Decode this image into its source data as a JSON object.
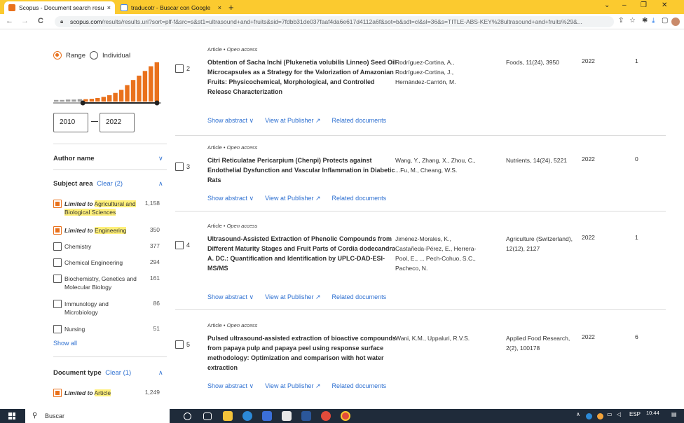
{
  "browser": {
    "tabs": [
      {
        "title": "Scopus - Document search results",
        "close": "×"
      },
      {
        "title": "traducotr - Buscar con Google",
        "close": "×"
      }
    ],
    "new_tab": "+",
    "window_controls": {
      "chevron": "⌄",
      "minimize": "–",
      "maximize": "❐",
      "close": "✕"
    },
    "nav": {
      "back": "←",
      "forward": "→",
      "reload": "C"
    },
    "url_host": "scopus.com",
    "url_path": "/results/results.uri?sort=plf-f&src=s&st1=ultrasound+and+fruits&sid=7fdbb31de037faaf4da6e617d4112a6f&sot=b&sdt=cl&sl=36&s=TITLE-ABS-KEY%28ultrasound+and+fruits%29&..."
  },
  "sidebar": {
    "range_label": "Range",
    "individual_label": "Individual",
    "histogram": {
      "values": [
        0.04,
        0.04,
        0.05,
        0.05,
        0.06,
        0.06,
        0.07,
        0.09,
        0.12,
        0.16,
        0.22,
        0.3,
        0.42,
        0.55,
        0.66,
        0.78,
        0.9,
        1.0
      ],
      "highlight_from": 5
    },
    "year_from": "2010",
    "year_to": "2022",
    "author_name": "Author name",
    "subject_area": "Subject area",
    "subject_clear": "Clear (2)",
    "subject_items": [
      {
        "prefix": "Limited to",
        "label": "Agricultural and Biological Sciences",
        "count": "1,158",
        "checked": true
      },
      {
        "prefix": "Limited to",
        "label": "Engineering",
        "count": "350",
        "checked": true
      },
      {
        "prefix": "",
        "label": "Chemistry",
        "count": "377",
        "checked": false
      },
      {
        "prefix": "",
        "label": "Chemical Engineering",
        "count": "294",
        "checked": false
      },
      {
        "prefix": "",
        "label": "Biochemistry, Genetics and Molecular Biology",
        "count": "161",
        "checked": false
      },
      {
        "prefix": "",
        "label": "Immunology and Microbiology",
        "count": "86",
        "checked": false
      },
      {
        "prefix": "",
        "label": "Nursing",
        "count": "51",
        "checked": false
      }
    ],
    "show_all": "Show all",
    "document_type": "Document type",
    "doctype_clear": "Clear (1)",
    "doctype_items": [
      {
        "prefix": "Limited to",
        "label": "Article",
        "count": "1,249",
        "checked": true
      }
    ]
  },
  "results": [
    {
      "num": "2",
      "type": "Article",
      "access": "Open access",
      "title": "Obtention of Sacha Inchi (Plukenetia volubilis Linneo) Seed Oil Microcapsules as a Strategy for the Valorization of Amazonian Fruits: Physicochemical, Morphological, and Controlled Release Characterization",
      "authors": "Rodríguez-Cortina, A., Rodríguez-Cortina, J., Hernández-Carrión, M.",
      "source": "Foods, 11(24), 3950",
      "year": "2022",
      "cited": "1"
    },
    {
      "num": "3",
      "type": "Article",
      "access": "Open access",
      "title": "Citri Reticulatae Pericarpium (Chenpi) Protects against Endothelial Dysfunction and Vascular Inflammation in Diabetic Rats",
      "authors": "Wang, Y., Zhang, X., Zhou, C., ...Fu, M., Cheang, W.S.",
      "source": "Nutrients, 14(24), 5221",
      "year": "2022",
      "cited": "0"
    },
    {
      "num": "4",
      "type": "Article",
      "access": "Open access",
      "title": "Ultrasound-Assisted Extraction of Phenolic Compounds from Different Maturity Stages and Fruit Parts of Cordia dodecandra A. DC.: Quantification and Identification by UPLC-DAD-ESI-MS/MS",
      "authors": "Jiménez-Morales, K., Castañeda-Pérez, E., Herrera-Pool, E., ... Pech-Cohuo, S.C., Pacheco, N.",
      "source": "Agriculture (Switzerland), 12(12), 2127",
      "year": "2022",
      "cited": "1"
    },
    {
      "num": "5",
      "type": "Article",
      "access": "Open access",
      "title": "Pulsed ultrasound-assisted extraction of bioactive compounds from papaya pulp and papaya peel using response surface methodology: Optimization and comparison with hot water extraction",
      "authors": "Wani, K.M., Uppaluri, R.V.S.",
      "source": "Applied Food Research, 2(2), 100178",
      "year": "2022",
      "cited": "6"
    }
  ],
  "result_links": {
    "show_abstract": "Show abstract ∨",
    "view_publisher": "View at Publisher ↗",
    "related": "Related documents"
  },
  "taskbar": {
    "search_placeholder": "Buscar",
    "lang": "ESP",
    "time": "10:44"
  },
  "colors": {
    "accent": "#e9711c",
    "link": "#2e70d1",
    "tabbar": "#fbca2f",
    "highlight": "#fff07a",
    "taskbar": "#1f2b3a"
  }
}
